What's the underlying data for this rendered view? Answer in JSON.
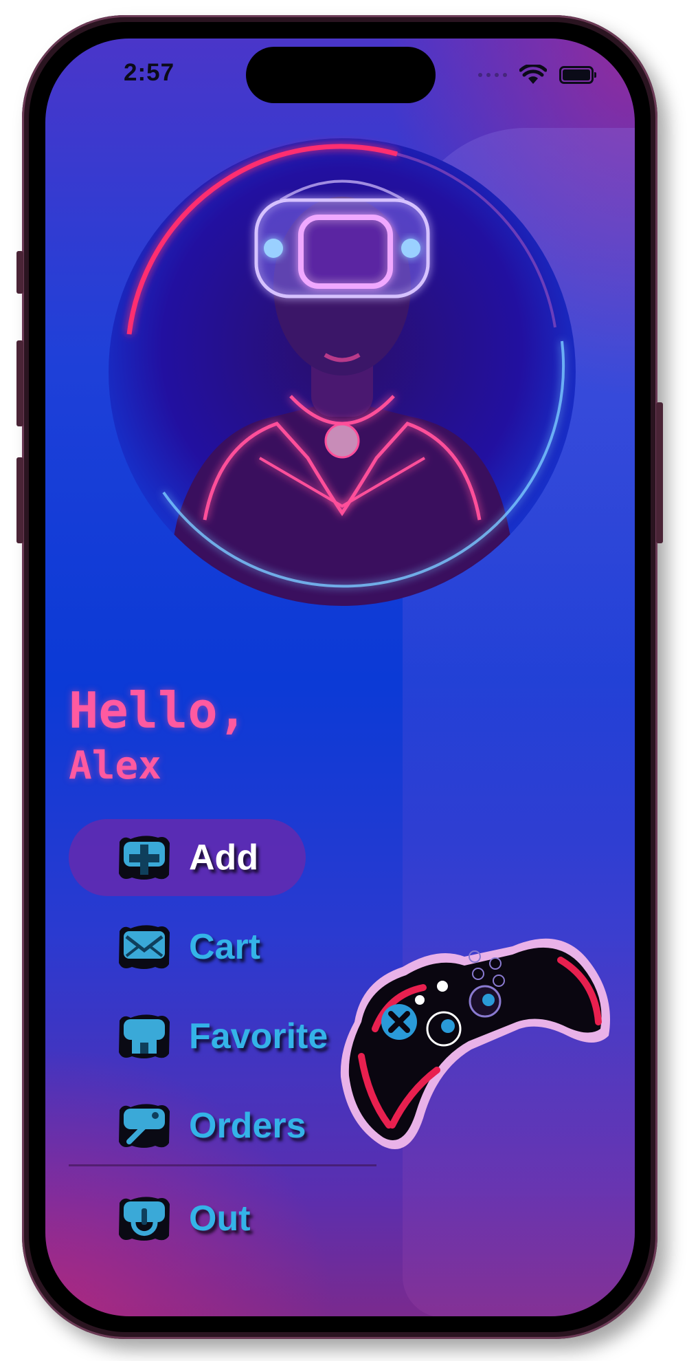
{
  "status_bar": {
    "time": "2:57",
    "icons": [
      "signal-dots-icon",
      "wifi-icon",
      "battery-icon"
    ]
  },
  "profile": {
    "greeting": "Hello,",
    "name": "Alex",
    "avatar_icon": "vr-headset-avatar-icon"
  },
  "menu": {
    "items": [
      {
        "label": "Add",
        "icon": "plus-icon",
        "active": true
      },
      {
        "label": "Cart",
        "icon": "envelope-icon",
        "active": false
      },
      {
        "label": "Favorite",
        "icon": "home-icon",
        "active": false
      },
      {
        "label": "Orders",
        "icon": "wrench-icon",
        "active": false
      }
    ],
    "logout": {
      "label": "Out",
      "icon": "power-icon"
    }
  },
  "colors": {
    "accent_pink": "#ff5aa0",
    "menu_text": "#34b3e8",
    "active_pill": "#6e28aa",
    "background_blue": "#0b3ad6"
  },
  "decor": {
    "controller_icon": "gamepad-icon"
  }
}
